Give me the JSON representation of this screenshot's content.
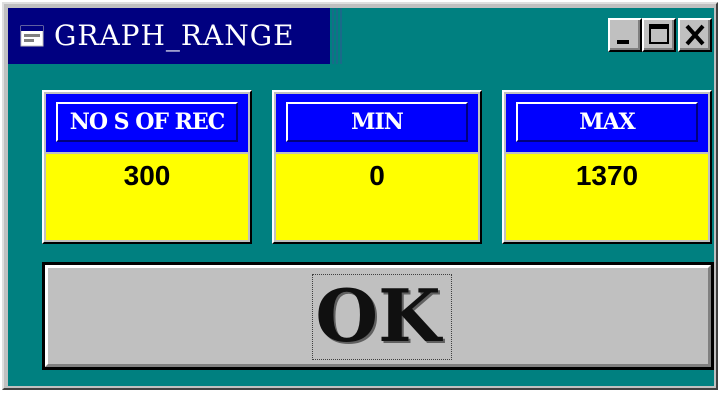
{
  "window": {
    "title": "GRAPH_RANGE",
    "icon": "app-window-icon",
    "controls": [
      "minimize-icon",
      "maximize-icon",
      "close-icon"
    ]
  },
  "fields": [
    {
      "label": "NO S OF REC",
      "value": "300"
    },
    {
      "label": "MIN",
      "value": "0"
    },
    {
      "label": "MAX",
      "value": "1370"
    }
  ],
  "ok_button": {
    "label": "OK"
  },
  "colors": {
    "title_active": "#000080",
    "client_bg": "#008080",
    "label_bg": "#0000ff",
    "value_bg": "#ffff00",
    "face": "#c0c0c0"
  }
}
